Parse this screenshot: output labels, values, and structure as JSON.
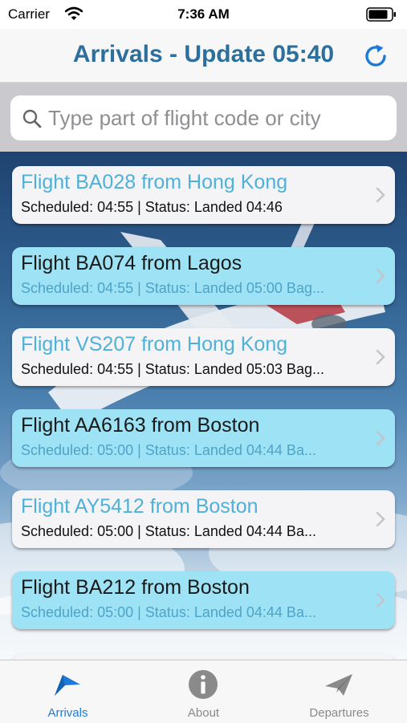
{
  "status_bar": {
    "carrier": "Carrier",
    "time": "7:36 AM"
  },
  "nav": {
    "title": "Arrivals - Update 05:40"
  },
  "search": {
    "placeholder": "Type part of flight code or city",
    "value": ""
  },
  "flights": [
    {
      "title": "Flight BA028 from Hong Kong",
      "subtitle": "Scheduled: 04:55 | Status: Landed 04:46",
      "style": "white"
    },
    {
      "title": "Flight BA074 from Lagos",
      "subtitle": "Scheduled: 04:55 | Status: Landed 05:00 Bag...",
      "style": "blue"
    },
    {
      "title": "Flight VS207 from Hong Kong",
      "subtitle": "Scheduled: 04:55 | Status: Landed 05:03 Bag...",
      "style": "white"
    },
    {
      "title": "Flight AA6163 from Boston",
      "subtitle": "Scheduled: 05:00 | Status: Landed 04:44 Ba...",
      "style": "blue"
    },
    {
      "title": "Flight AY5412 from Boston",
      "subtitle": "Scheduled: 05:00 | Status: Landed 04:44 Ba...",
      "style": "white"
    },
    {
      "title": "Flight BA212 from Boston",
      "subtitle": "Scheduled: 05:00 | Status: Landed 04:44 Ba...",
      "style": "blue"
    }
  ],
  "tabs": [
    {
      "label": "Arrivals",
      "icon": "arrivals-plane-icon",
      "active": true
    },
    {
      "label": "About",
      "icon": "info-icon",
      "active": false
    },
    {
      "label": "Departures",
      "icon": "departures-plane-icon",
      "active": false
    }
  ],
  "colors": {
    "accent": "#1e7ad8",
    "title": "#2d6f9c",
    "card_blue": "#9ee3f5",
    "card_white": "#f4f4f6",
    "inactive": "#8a8a8a"
  }
}
